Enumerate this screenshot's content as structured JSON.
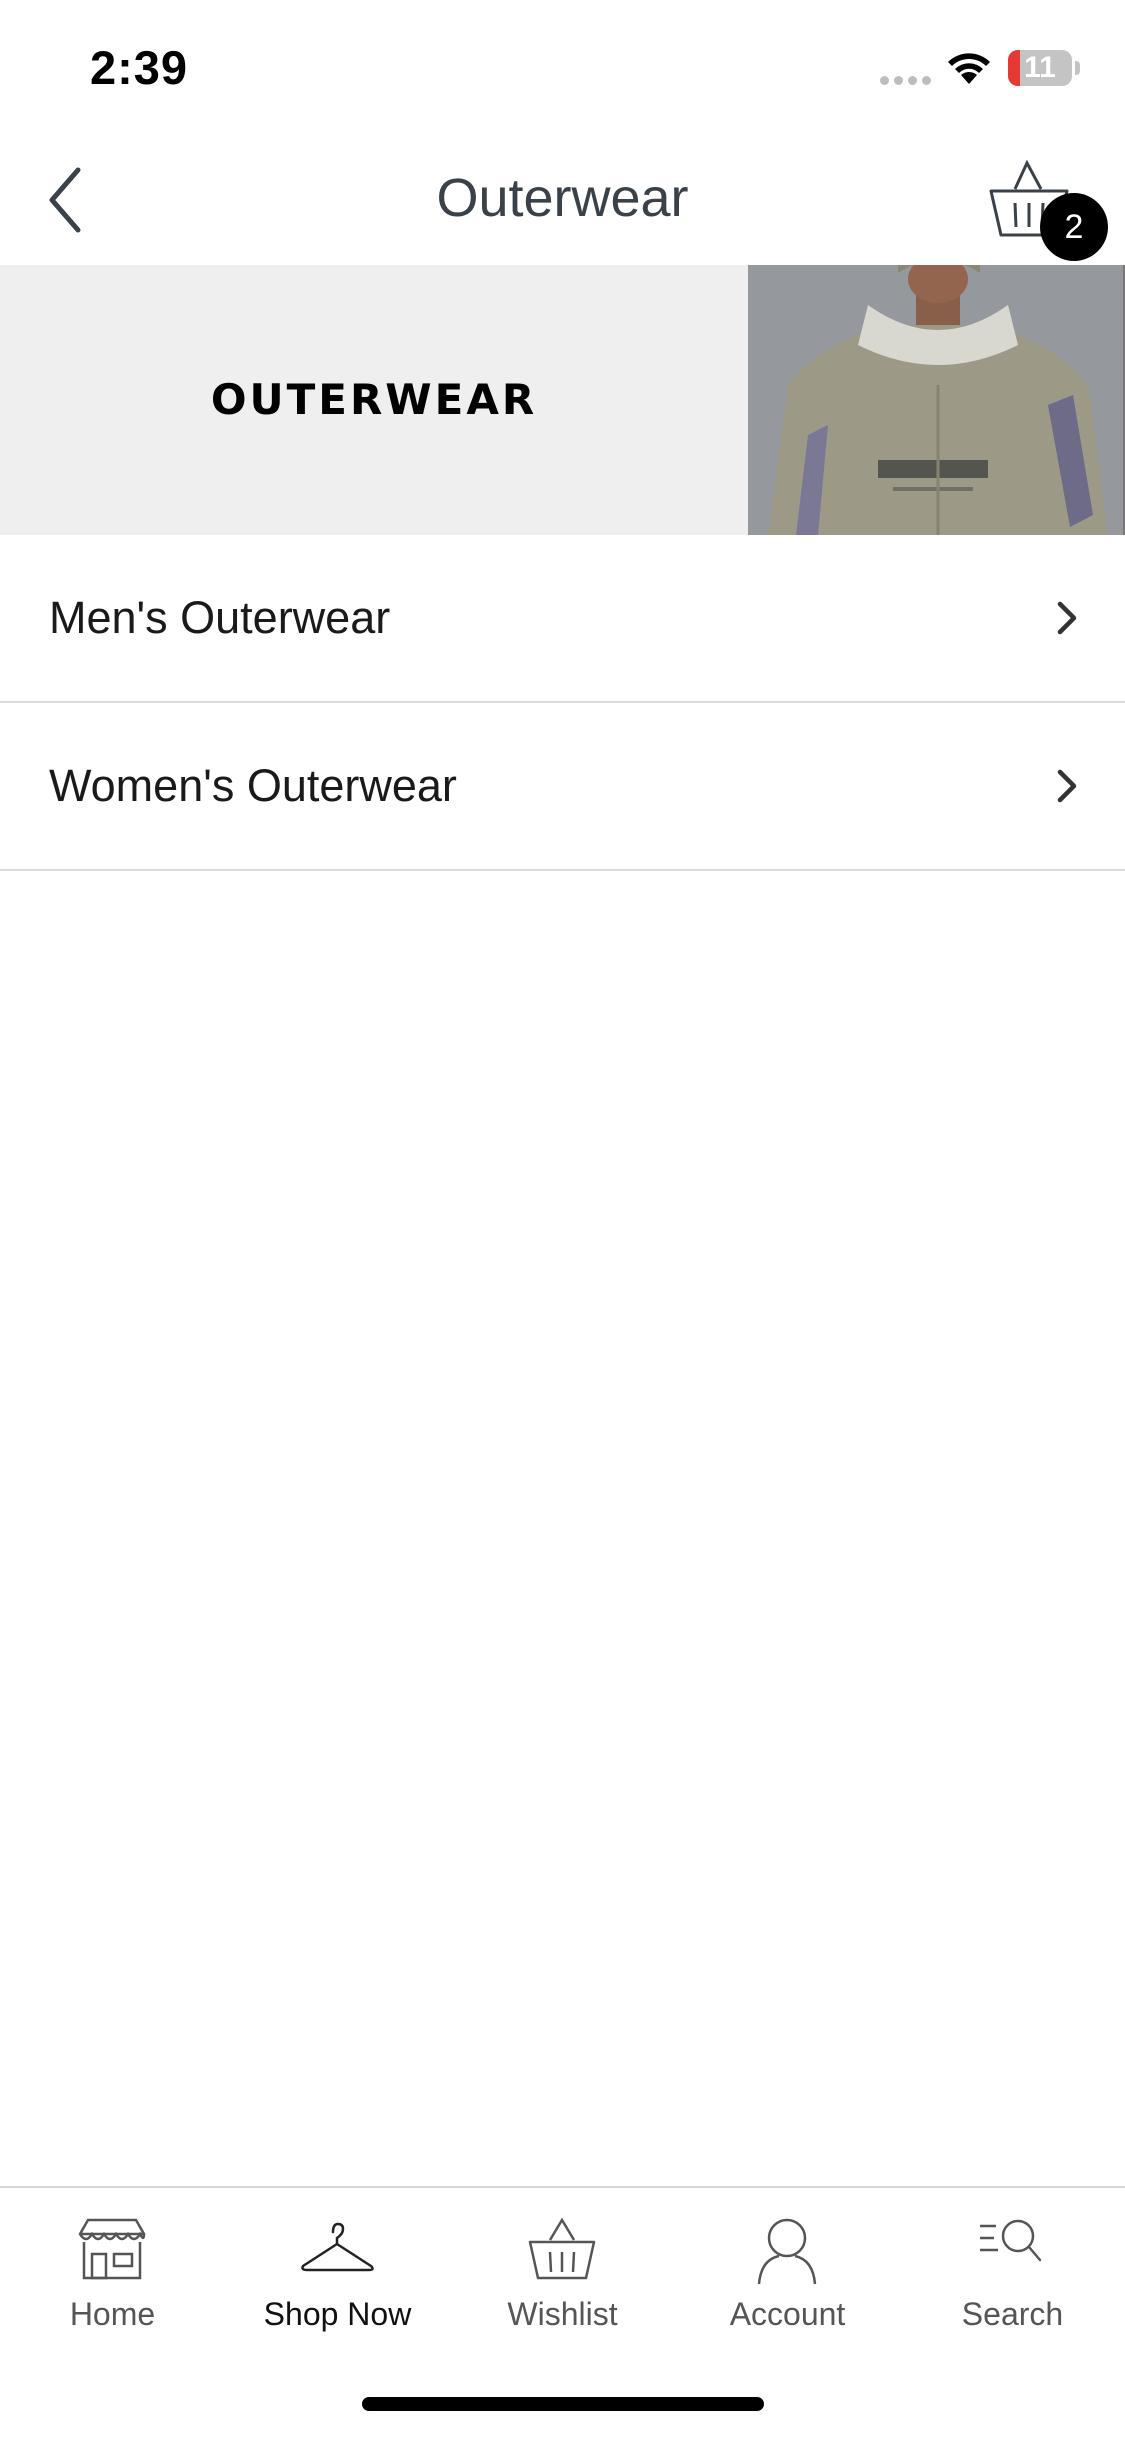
{
  "status_bar": {
    "time": "2:39",
    "battery_level": "11",
    "battery_color": "#e53935"
  },
  "header": {
    "title": "Outerwear",
    "back_icon": "chevron-left-icon",
    "basket_icon": "basket-icon",
    "basket_count": "2"
  },
  "banner": {
    "title": "OUTERWEAR",
    "photo_description_icon": "model-photo"
  },
  "categories": [
    {
      "label": "Men's Outerwear",
      "icon": "chevron-right-icon"
    },
    {
      "label": "Women's Outerwear",
      "icon": "chevron-right-icon"
    }
  ],
  "tab_bar": {
    "active_tab": "Shop Now",
    "tabs": [
      {
        "label": "Home",
        "icon": "storefront-icon"
      },
      {
        "label": "Shop Now",
        "icon": "hanger-icon"
      },
      {
        "label": "Wishlist",
        "icon": "basket-icon"
      },
      {
        "label": "Account",
        "icon": "person-icon"
      },
      {
        "label": "Search",
        "icon": "search-list-icon"
      }
    ]
  },
  "colors": {
    "title_text": "#3a4149",
    "banner_background": "#efefef",
    "divider": "#dadada",
    "badge": "#000000"
  }
}
